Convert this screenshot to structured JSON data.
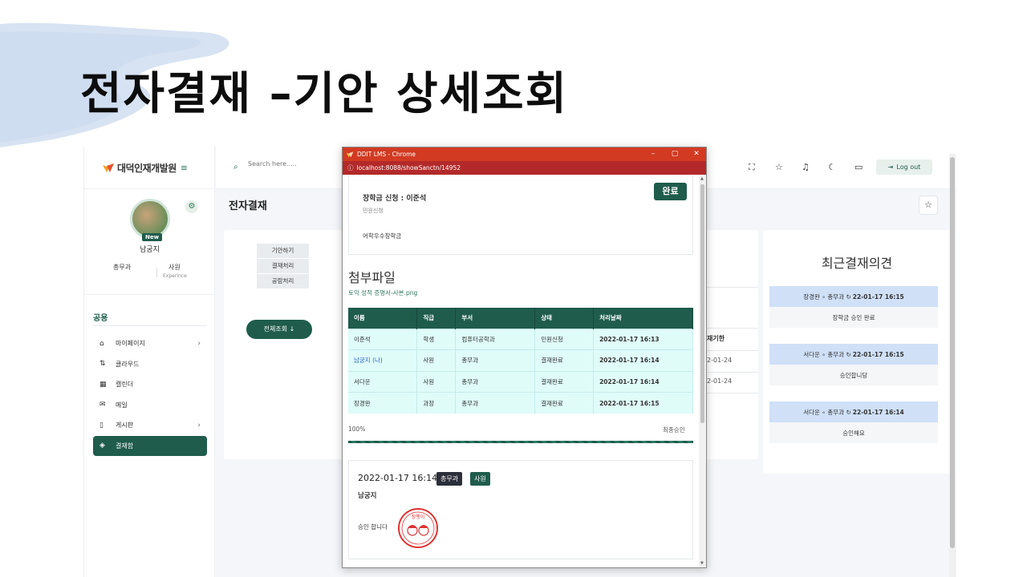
{
  "slide": {
    "title": "전자결재 –기안 상세조회"
  },
  "app": {
    "logo": {
      "text": "대덕인재개발원",
      "lines": "≡"
    },
    "profile": {
      "name": "남궁지",
      "dept": "총무과",
      "rank": "사원",
      "rank_sub": "Experince",
      "badge": "New"
    },
    "section": "공용",
    "menu": [
      {
        "label": "마이페이지",
        "icon": "⌂",
        "chevron": "›"
      },
      {
        "label": "클라우드",
        "icon": "⇅",
        "chevron": ""
      },
      {
        "label": "캘린더",
        "icon": "▦",
        "chevron": ""
      },
      {
        "label": "메일",
        "icon": "✉",
        "chevron": ""
      },
      {
        "label": "게시판",
        "icon": "▯",
        "chevron": "›"
      },
      {
        "label": "결재함",
        "icon": "◈",
        "chevron": ""
      }
    ],
    "topbar": {
      "search_placeholder": "Search here.....",
      "logout": "Log out"
    },
    "page_title": "전자결재",
    "types": [
      "기안하기",
      "결재처리",
      "공람처리"
    ],
    "all_button": "전체조회 ↓",
    "bg_table": {
      "col_header": "재기한",
      "dates": [
        "2-01-24",
        "2-01-24"
      ]
    },
    "recent": {
      "title": "최근결재의견",
      "items": [
        {
          "who": "장경완 ∘ 총무과 ↻",
          "when": "22-01-17 16:15",
          "text": "장학금 승인 완료"
        },
        {
          "who": "서다운 ∘ 총무과 ↻",
          "when": "22-01-17 16:15",
          "text": "승인합니당"
        },
        {
          "who": "서다운 ∘ 총무과 ↻",
          "when": "22-01-17 16:14",
          "text": "승인해요"
        }
      ]
    }
  },
  "popup": {
    "window_title": "DDIT LMS - Chrome",
    "url": "localhost:8088/showSanctn/14952",
    "request": {
      "title": "장학금 신청 : 이준석",
      "sub": "민원신청",
      "body": "어학우수장학금",
      "status": "완료"
    },
    "attachments": {
      "title": "첨부파일",
      "file": "토익 성적 증명서-사본.png"
    },
    "table": {
      "headers": [
        "이름",
        "직급",
        "부서",
        "상태",
        "처리날짜"
      ],
      "rows": [
        [
          "이준석",
          "학생",
          "컴퓨터공학과",
          "민원신청",
          "2022-01-17 16:13"
        ],
        [
          "남궁지 (나)",
          "사원",
          "총무과",
          "결재완료",
          "2022-01-17 16:14"
        ],
        [
          "서다운",
          "사원",
          "총무과",
          "결재완료",
          "2022-01-17 16:14"
        ],
        [
          "장경완",
          "과장",
          "총무과",
          "결재완료",
          "2022-01-17 16:15"
        ]
      ]
    },
    "progress": {
      "label": "100%",
      "value": 100,
      "status": "최종승인"
    },
    "opinion": {
      "date": "2022-01-17 16:14",
      "dept": "총무과",
      "rank": "사원",
      "name": "남궁지",
      "text": "승인 합니다",
      "stamp_text": "장행이"
    }
  },
  "colors": {
    "primary": "#1f5c4c",
    "title_bar": "#d23a22",
    "row_bg": "#dffcf9",
    "recent_head": "#cfe0f7"
  }
}
